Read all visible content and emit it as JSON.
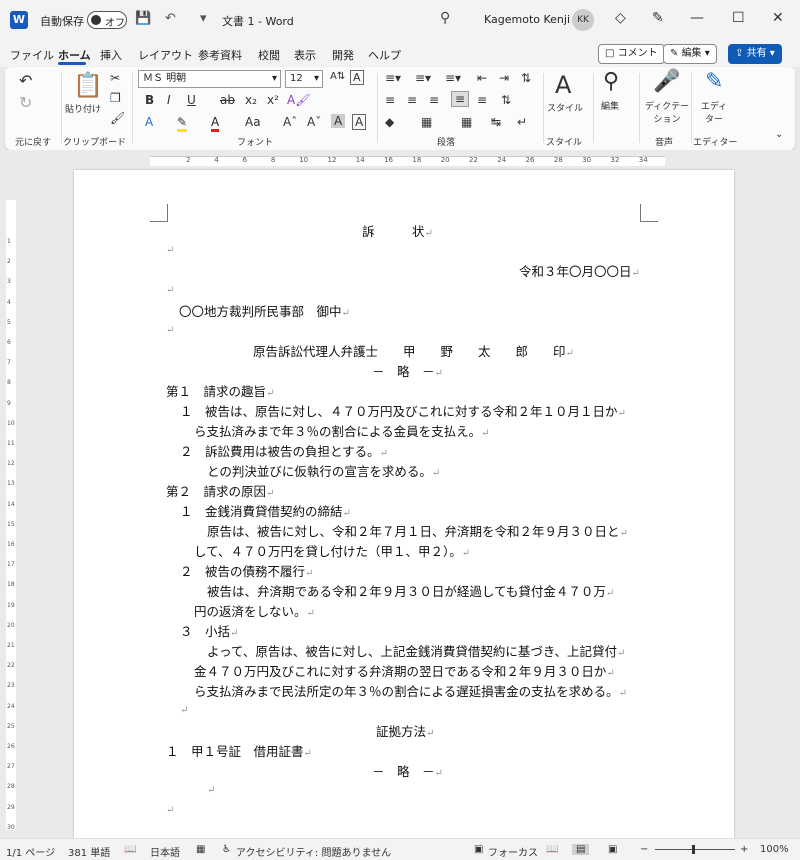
{
  "app": {
    "title": "文書 1  -  Word",
    "autosave_label": "自動保存",
    "autosave_state": "オフ",
    "user_name": "Kagemoto Kenji",
    "user_initials": "KK",
    "logo": "W"
  },
  "tabs": [
    "ファイル",
    "ホーム",
    "挿入",
    "レイアウト",
    "参考資料",
    "校閲",
    "表示",
    "開発",
    "ヘルプ"
  ],
  "header_buttons": {
    "comment": "コメント",
    "edit": "編集",
    "share": "共有"
  },
  "ribbon": {
    "groups": {
      "undo": "元に戻す",
      "clipboard": "クリップボード",
      "font": "フォント",
      "paragraph": "段落",
      "styles": "スタイル",
      "voice": "音声",
      "editor": "エディター"
    },
    "paste_label": "貼り付け",
    "font_name": "ＭＳ 明朝",
    "font_size": "12",
    "styles_label": "スタイル",
    "editing_label": "編集",
    "dictate_label": "ディクテーション",
    "editor_label": "エディター"
  },
  "ruler": [
    "2",
    "4",
    "6",
    "8",
    "10",
    "12",
    "14",
    "16",
    "18",
    "20",
    "22",
    "24",
    "26",
    "28",
    "30",
    "32",
    "34"
  ],
  "vruler": [
    "1",
    "2",
    "3",
    "4",
    "5",
    "6",
    "7",
    "8",
    "9",
    "10",
    "11",
    "12",
    "13",
    "14",
    "15",
    "16",
    "17",
    "18",
    "19",
    "20",
    "21",
    "22",
    "23",
    "24",
    "25",
    "26",
    "27",
    "28",
    "29",
    "30"
  ],
  "document": {
    "lines": [
      "訴　　　状",
      "",
      "令和３年〇月〇〇日",
      "",
      "〇〇地方裁判所民事部　御中",
      "",
      "原告訴訟代理人弁護士　　甲　　野　　太　　郎　　印",
      "－　略　－",
      "第１　請求の趣旨",
      "１　被告は、原告に対し、４７０万円及びこれに対する令和２年１０月１日か",
      "ら支払済みまで年３％の割合による金員を支払え。",
      "２　訴訟費用は被告の負担とする。",
      "との判決並びに仮執行の宣言を求める。",
      "第２　請求の原因",
      "１　金銭消費貸借契約の締結",
      "原告は、被告に対し、令和２年７月１日、弁済期を令和２年９月３０日と",
      "して、４７０万円を貸し付けた（甲１、甲２）。",
      "２　被告の債務不履行",
      "被告は、弁済期である令和２年９月３０日が経過しても貸付金４７０万",
      "円の返済をしない。",
      "３　小括",
      "よって、原告は、被告に対し、上記金銭消費貸借契約に基づき、上記貸付",
      "金４７０万円及びこれに対する弁済期の翌日である令和２年９月３０日か",
      "ら支払済みまで民法所定の年３％の割合による遅延損害金の支払を求める。",
      "",
      "証拠方法",
      "１　甲１号証　借用証書",
      "－　略　－",
      "",
      ""
    ]
  },
  "status": {
    "page": "1/1 ページ",
    "words": "381 単語",
    "language": "日本語",
    "accessibility": "アクセシビリティ: 問題ありません",
    "focus": "フォーカス",
    "zoom": "100%"
  }
}
